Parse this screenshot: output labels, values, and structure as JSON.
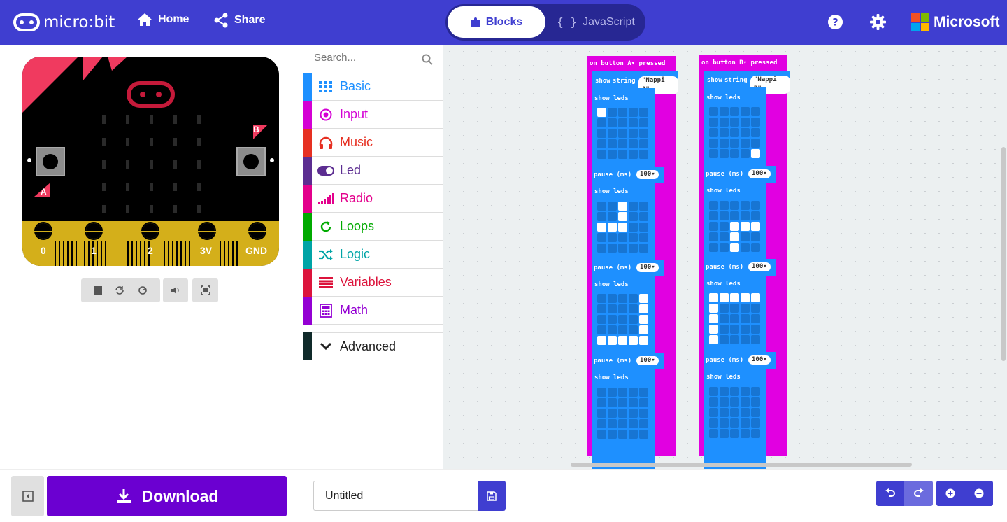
{
  "header": {
    "logo_text": "micro:bit",
    "home_label": "Home",
    "share_label": "Share",
    "blocks_label": "Blocks",
    "js_label": "JavaScript",
    "ms_label": "Microsoft",
    "brand_color": "#3f3ed0"
  },
  "simulator": {
    "pins": [
      "0",
      "1",
      "2",
      "3V",
      "GND"
    ],
    "button_a": "A",
    "button_b": "B",
    "controls": [
      "stop-icon",
      "restart-icon",
      "slow-mo-icon",
      "mute-icon",
      "fullscreen-icon"
    ]
  },
  "toolbox": {
    "search_placeholder": "Search...",
    "categories": [
      {
        "label": "Basic",
        "color": "#1e90ff",
        "icon": "grid-icon"
      },
      {
        "label": "Input",
        "color": "#d400d4",
        "icon": "target-icon"
      },
      {
        "label": "Music",
        "color": "#e63022",
        "icon": "headphones-icon"
      },
      {
        "label": "Led",
        "color": "#5c2d91",
        "icon": "toggle-icon"
      },
      {
        "label": "Radio",
        "color": "#e3008c",
        "icon": "signal-icon"
      },
      {
        "label": "Loops",
        "color": "#00aa00",
        "icon": "refresh-icon"
      },
      {
        "label": "Logic",
        "color": "#00a4a6",
        "icon": "shuffle-icon"
      },
      {
        "label": "Variables",
        "color": "#dc143c",
        "icon": "lines-icon"
      },
      {
        "label": "Math",
        "color": "#9400d3",
        "icon": "calculator-icon"
      }
    ],
    "advanced_label": "Advanced"
  },
  "workspace": {
    "scripts": [
      {
        "event_prefix": "on button",
        "button": "A",
        "event_suffix": "pressed",
        "show_string_label": "show",
        "string_kw": "string",
        "string_value": "\"Nappi A\"",
        "show_leds_label": "show leds",
        "pause_label": "pause (ms)",
        "pause_value": "100",
        "frames": [
          [
            "10000",
            "00000",
            "00000",
            "00000",
            "00000"
          ],
          [
            "00100",
            "00100",
            "11100",
            "00000",
            "00000"
          ],
          [
            "00001",
            "00001",
            "00001",
            "00001",
            "11111"
          ],
          [
            "00000",
            "00000",
            "00000",
            "00000",
            "00000"
          ]
        ]
      },
      {
        "event_prefix": "on button",
        "button": "B",
        "event_suffix": "pressed",
        "show_string_label": "show",
        "string_kw": "string",
        "string_value": "\"Nappi B\"",
        "show_leds_label": "show leds",
        "pause_label": "pause (ms)",
        "pause_value": "100",
        "frames": [
          [
            "00000",
            "00000",
            "00000",
            "00000",
            "00001"
          ],
          [
            "00000",
            "00000",
            "00111",
            "00100",
            "00100"
          ],
          [
            "11111",
            "10000",
            "10000",
            "10000",
            "10000"
          ],
          [
            "00000",
            "00000",
            "00000",
            "00000",
            "00000"
          ]
        ]
      }
    ]
  },
  "footer": {
    "download_label": "Download",
    "project_name": "Untitled"
  }
}
